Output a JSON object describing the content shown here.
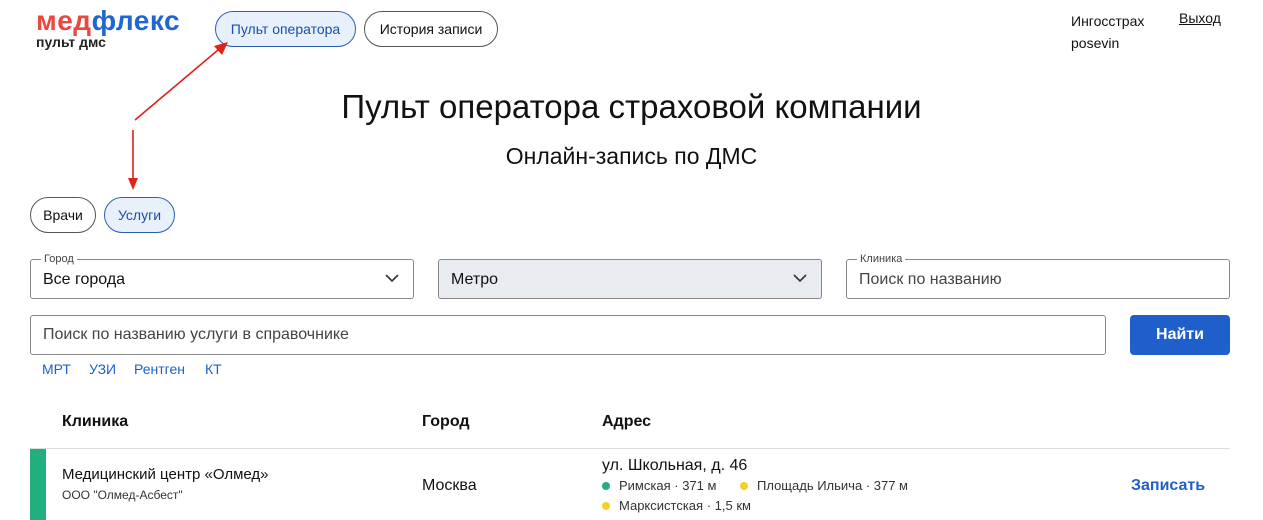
{
  "logo": {
    "main_part1": "мед",
    "main_part2": "флекс",
    "sub": "пульт дмс"
  },
  "nav": {
    "operator_label": "Пульт оператора",
    "history_label": "История записи"
  },
  "user": {
    "company": "Ингосстрах",
    "login": "posevin",
    "logout_label": "Выход"
  },
  "page": {
    "title": "Пульт оператора страховой компании",
    "subtitle": "Онлайн-запись по ДМС"
  },
  "mode_tabs": {
    "doctors_label": "Врачи",
    "services_label": "Услуги"
  },
  "filters": {
    "city": {
      "label": "Город",
      "value": "Все города"
    },
    "metro": {
      "value": "Метро"
    },
    "clinic": {
      "label": "Клиника",
      "placeholder": "Поиск по названию"
    }
  },
  "search": {
    "placeholder": "Поиск по названию услуги в справочнике",
    "button_label": "Найти"
  },
  "quick_links": [
    "МРТ",
    "УЗИ",
    "Рентген",
    "КТ"
  ],
  "table": {
    "headers": {
      "clinic": "Клиника",
      "city": "Город",
      "address": "Адрес"
    },
    "rows": [
      {
        "clinic_name": "Медицинский центр «Олмед»",
        "clinic_org": "ООО \"Олмед-Асбест\"",
        "city": "Москва",
        "address": "ул. Школьная, д. 46",
        "metro": [
          {
            "name": "Римская",
            "distance": "371 м",
            "color": "#21b07b"
          },
          {
            "name": "Площадь Ильича",
            "distance": "377 м",
            "color": "#f4d21f"
          },
          {
            "name": "Марксистская",
            "distance": "1,5 км",
            "color": "#f4d21f"
          }
        ],
        "book_label": "Записать"
      }
    ]
  },
  "colors": {
    "brand_red": "#e8483d",
    "brand_blue": "#1e66d2",
    "accent": "#1e5fcc",
    "annotation_arrow": "#e0221b"
  }
}
